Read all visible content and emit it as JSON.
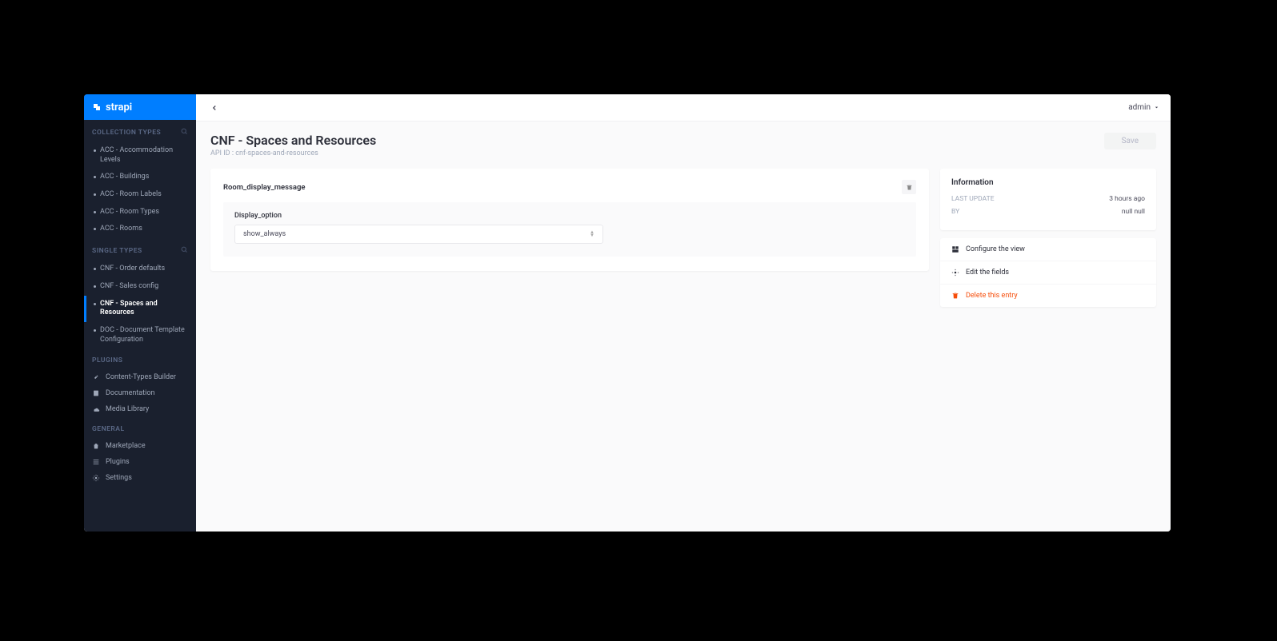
{
  "brand": "strapi",
  "user_menu": {
    "label": "admin"
  },
  "sidebar": {
    "sections": {
      "collection_types": {
        "header": "COLLECTION TYPES"
      },
      "single_types": {
        "header": "SINGLE TYPES"
      },
      "plugins": {
        "header": "PLUGINS"
      },
      "general": {
        "header": "GENERAL"
      }
    },
    "collection_types": [
      {
        "label": "ACC - Accommodation Levels"
      },
      {
        "label": "ACC - Buildings"
      },
      {
        "label": "ACC - Room Labels"
      },
      {
        "label": "ACC - Room Types"
      },
      {
        "label": "ACC - Rooms"
      }
    ],
    "single_types": [
      {
        "label": "CNF - Order defaults"
      },
      {
        "label": "CNF - Sales config"
      },
      {
        "label": "CNF - Spaces and Resources"
      },
      {
        "label": "DOC - Document Template Configuration"
      }
    ],
    "plugins": [
      {
        "label": "Content-Types Builder"
      },
      {
        "label": "Documentation"
      },
      {
        "label": "Media Library"
      }
    ],
    "general": [
      {
        "label": "Marketplace"
      },
      {
        "label": "Plugins"
      },
      {
        "label": "Settings"
      }
    ]
  },
  "page": {
    "title": "CNF - Spaces and Resources",
    "api_id": "API ID : cnf-spaces-and-resources",
    "save_label": "Save"
  },
  "form": {
    "component_title": "Room_display_message",
    "field_label": "Display_option",
    "field_value": "show_always"
  },
  "info_panel": {
    "title": "Information",
    "rows": [
      {
        "label": "LAST UPDATE",
        "value": "3 hours ago"
      },
      {
        "label": "BY",
        "value": "null null"
      }
    ]
  },
  "actions": {
    "configure": "Configure the view",
    "edit_fields": "Edit the fields",
    "delete": "Delete this entry"
  }
}
